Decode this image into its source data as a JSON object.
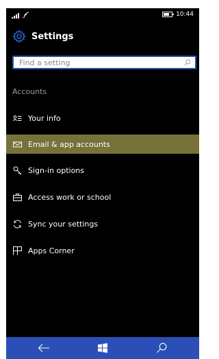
{
  "status_bar": {
    "time": "10:44"
  },
  "header": {
    "title": "Settings",
    "icon": "gear-icon"
  },
  "search": {
    "placeholder": "Find a setting",
    "icon": "search-icon"
  },
  "section": {
    "label": "Accounts"
  },
  "menu": {
    "items": [
      {
        "label": "Your info",
        "icon": "contact-card-icon",
        "selected": false
      },
      {
        "label": "Email & app accounts",
        "icon": "mail-icon",
        "selected": true
      },
      {
        "label": "Sign-in options",
        "icon": "key-icon",
        "selected": false
      },
      {
        "label": "Access work or school",
        "icon": "briefcase-icon",
        "selected": false
      },
      {
        "label": "Sync your settings",
        "icon": "sync-icon",
        "selected": false
      },
      {
        "label": "Apps Corner",
        "icon": "apps-corner-icon",
        "selected": false
      }
    ]
  },
  "nav_bar": {
    "buttons": [
      "back-icon",
      "windows-icon",
      "search-icon"
    ]
  },
  "colors": {
    "background": "#000000",
    "accent": "#2b4fb6",
    "selected_row": "#77713a",
    "section_label": "#9a9a9a"
  }
}
